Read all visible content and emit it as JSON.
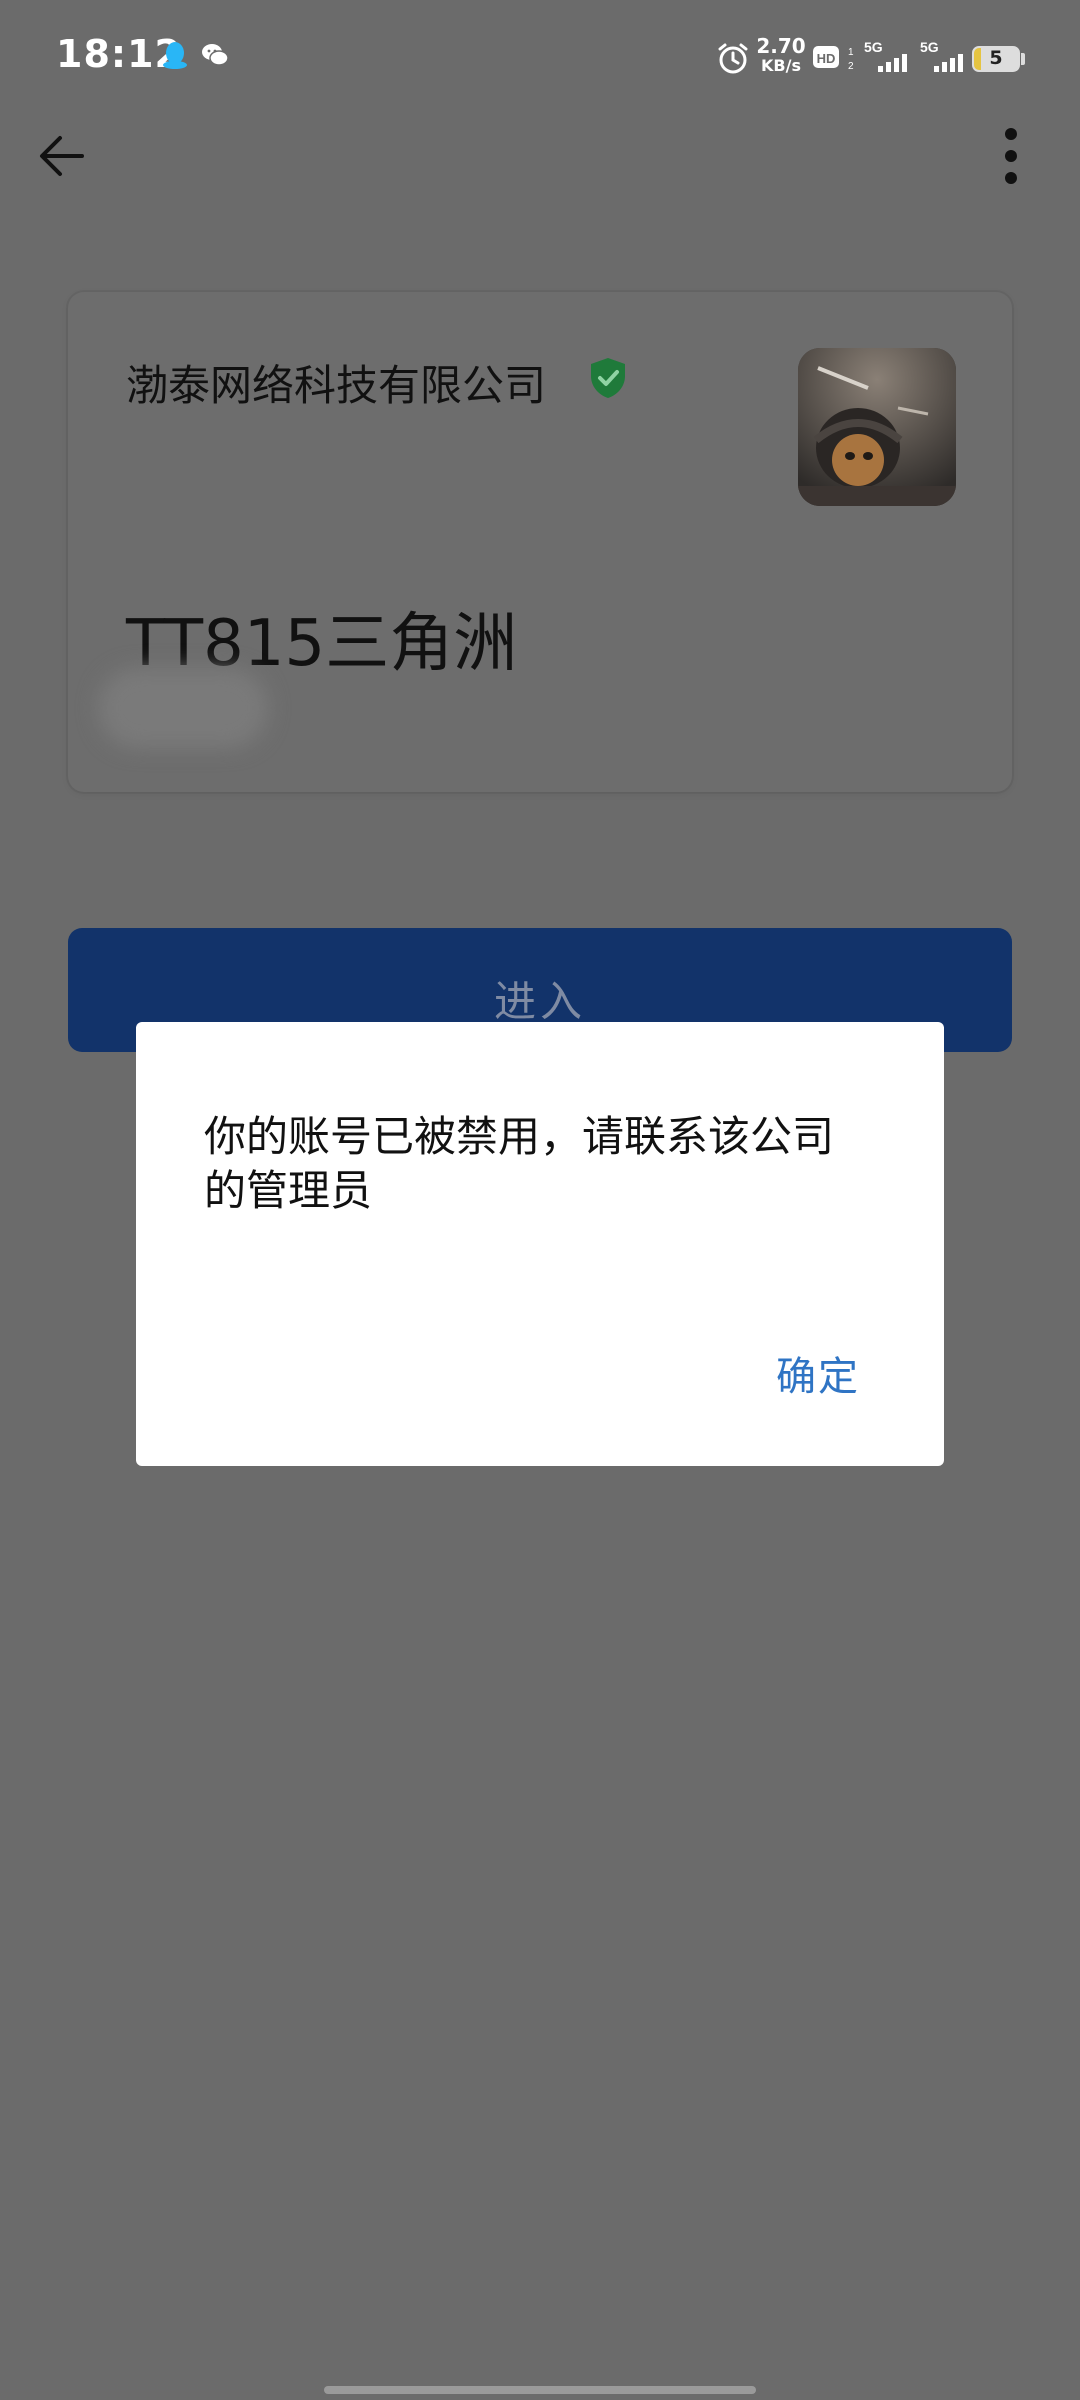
{
  "status_bar": {
    "time": "18:12",
    "net_speed_value": "2.70",
    "net_speed_unit": "KB/s",
    "signal_1": "5G",
    "signal_2": "5G",
    "battery_level": "5",
    "icons": [
      "qq-icon",
      "wechat-icon",
      "alarm-icon",
      "hd-volte-icon",
      "signal-5g-icon",
      "signal-5g-icon",
      "battery-icon"
    ]
  },
  "top_bar": {
    "back_icon": "arrow-left-icon",
    "more_icon": "more-vertical-icon"
  },
  "company_card": {
    "company_name": "渤泰网络科技有限公司",
    "verified_icon": "shield-check-icon",
    "team_name": "TT815三角洲"
  },
  "enter_button": {
    "label": "进入"
  },
  "dialog": {
    "message": "你的账号已被禁用，请联系该公司的管理员",
    "confirm_label": "确定"
  },
  "colors": {
    "overlay_background": "#6b6b6b",
    "enter_button": "#12336a",
    "dialog_background": "#ffffff",
    "confirm_text": "#2f74c4",
    "verified_badge": "#1f7a3a"
  }
}
